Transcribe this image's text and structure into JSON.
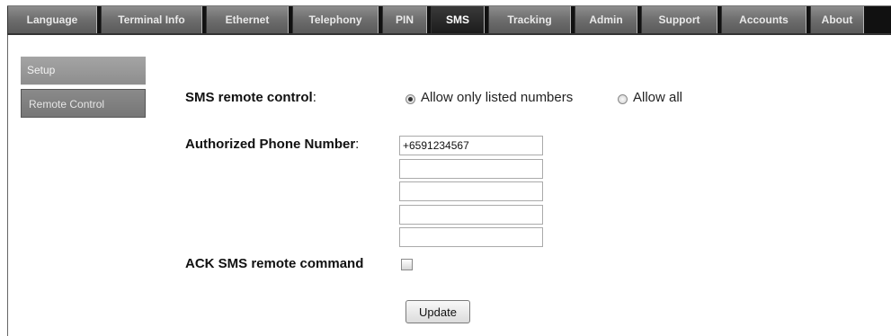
{
  "tabs": [
    {
      "label": "Language",
      "active": false
    },
    {
      "label": "Terminal Info",
      "active": false
    },
    {
      "label": "Ethernet",
      "active": false
    },
    {
      "label": "Telephony",
      "active": false
    },
    {
      "label": "PIN",
      "active": false
    },
    {
      "label": "SMS",
      "active": true
    },
    {
      "label": "Tracking",
      "active": false
    },
    {
      "label": "Admin",
      "active": false
    },
    {
      "label": "Support",
      "active": false
    },
    {
      "label": "Accounts",
      "active": false
    },
    {
      "label": "About",
      "active": false
    }
  ],
  "sidebar": {
    "items": [
      {
        "label": "Setup"
      },
      {
        "label": "Remote Control"
      }
    ]
  },
  "form": {
    "remote_label": "SMS remote control",
    "remote_colon": ":",
    "radio_options": [
      {
        "label": "Allow only listed numbers",
        "selected": true
      },
      {
        "label": "Allow all",
        "selected": false
      }
    ],
    "phone_label": "Authorized Phone Number",
    "phone_colon": ":",
    "phone_numbers": [
      "+6591234567",
      "",
      "",
      "",
      ""
    ],
    "ack_label": "ACK SMS remote command",
    "ack_checked": false,
    "update_label": "Update"
  }
}
